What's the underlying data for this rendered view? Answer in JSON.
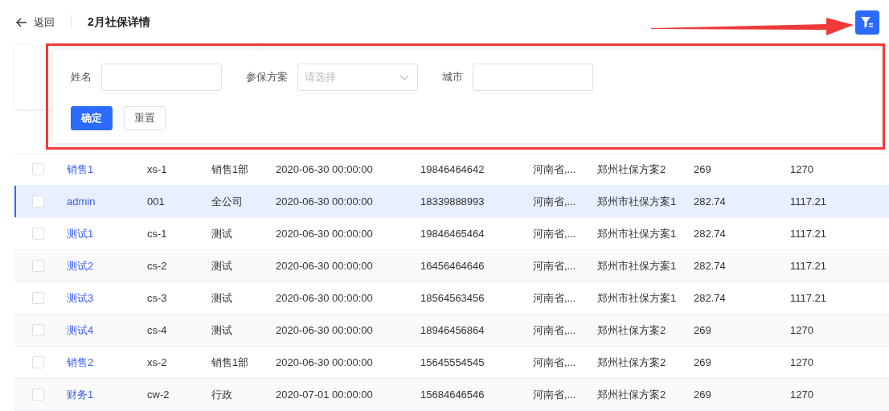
{
  "header": {
    "back_label": "返回",
    "title": "2月社保详情"
  },
  "filter_panel": {
    "fields": [
      {
        "kind": "text",
        "label": "姓名"
      },
      {
        "kind": "select",
        "label": "参保方案",
        "placeholder": "请选择"
      },
      {
        "kind": "text",
        "label": "城市"
      }
    ],
    "buttons": [
      {
        "kind": "primary",
        "label": "确定"
      },
      {
        "kind": "default",
        "label": "重置"
      }
    ]
  },
  "table": {
    "rows": [
      {
        "selected": false,
        "checked": false,
        "cells": [
          "销售1",
          "xs-1",
          "销售1部",
          "2020-06-30 00:00:00",
          "19846464642",
          "河南省,...",
          "郑州社保方案2",
          "269",
          "1270"
        ]
      },
      {
        "selected": true,
        "checked": false,
        "cells": [
          "admin",
          "001",
          "全公司",
          "2020-06-30 00:00:00",
          "18339888993",
          "河南省,...",
          "郑州市社保方案1",
          "282.74",
          "1117.21"
        ]
      },
      {
        "selected": false,
        "checked": false,
        "cells": [
          "测试1",
          "cs-1",
          "测试",
          "2020-06-30 00:00:00",
          "19846465464",
          "河南省,...",
          "郑州市社保方案1",
          "282.74",
          "1117.21"
        ]
      },
      {
        "selected": false,
        "checked": false,
        "cells": [
          "测试2",
          "cs-2",
          "测试",
          "2020-06-30 00:00:00",
          "16456464646",
          "河南省,...",
          "郑州市社保方案1",
          "282.74",
          "1117.21"
        ]
      },
      {
        "selected": false,
        "checked": false,
        "cells": [
          "测试3",
          "cs-3",
          "测试",
          "2020-06-30 00:00:00",
          "18564563456",
          "河南省,...",
          "郑州市社保方案1",
          "282.74",
          "1117.21"
        ]
      },
      {
        "selected": false,
        "checked": false,
        "cells": [
          "测试4",
          "cs-4",
          "测试",
          "2020-06-30 00:00:00",
          "18946456864",
          "河南省,...",
          "郑州社保方案2",
          "269",
          "1270"
        ]
      },
      {
        "selected": false,
        "checked": false,
        "cells": [
          "销售2",
          "xs-2",
          "销售1部",
          "2020-06-30 00:00:00",
          "15645554545",
          "河南省,...",
          "郑州社保方案2",
          "269",
          "1270"
        ]
      },
      {
        "selected": false,
        "checked": false,
        "cells": [
          "财务1",
          "cw-2",
          "行政",
          "2020-07-01 00:00:00",
          "15684646546",
          "河南省,...",
          "郑州社保方案2",
          "269",
          "1270"
        ]
      }
    ]
  }
}
